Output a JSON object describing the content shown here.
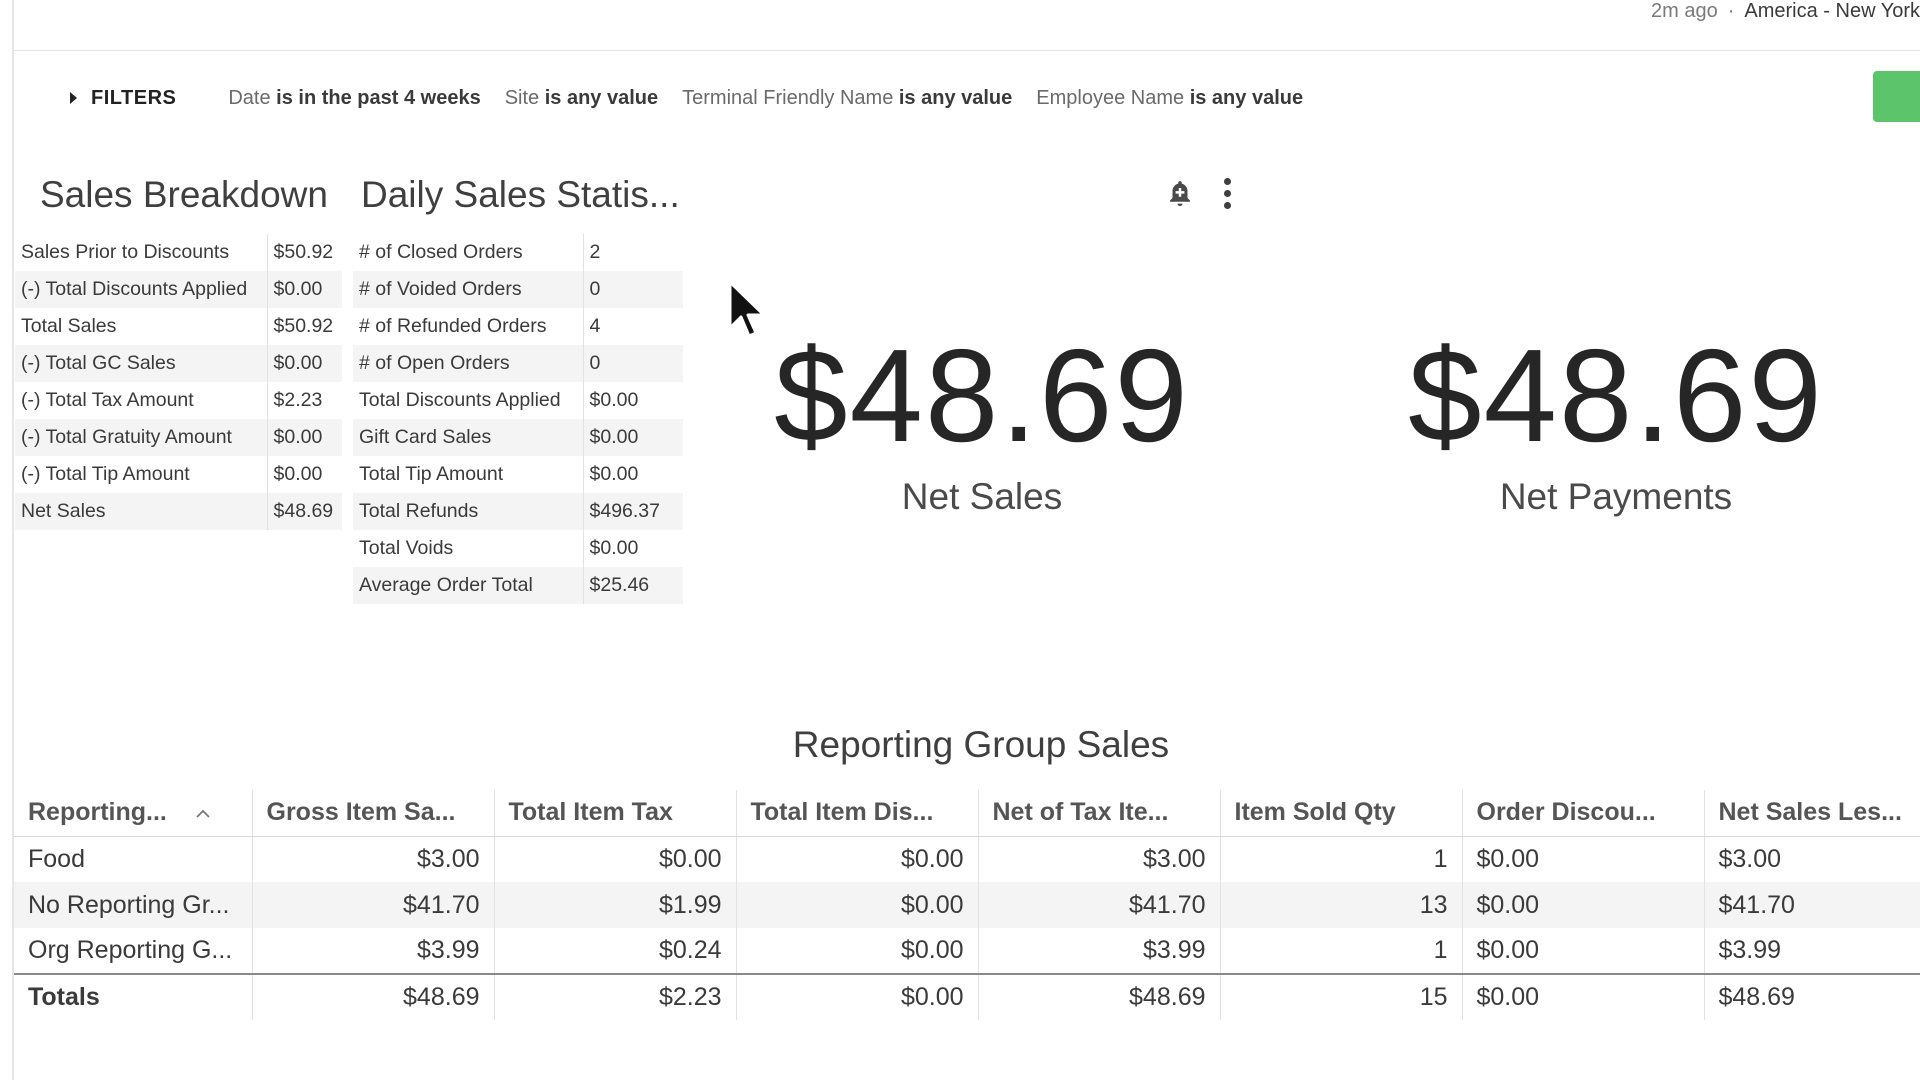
{
  "header": {
    "updated": "2m ago",
    "separator": "·",
    "timezone": "America - New York"
  },
  "filters": {
    "title": "FILTERS",
    "items": [
      {
        "field": "Date",
        "condition": "is in the past 4 weeks"
      },
      {
        "field": "Site",
        "condition": "is any value"
      },
      {
        "field": "Terminal Friendly Name",
        "condition": "is any value"
      },
      {
        "field": "Employee Name",
        "condition": "is any value"
      }
    ]
  },
  "sales_breakdown": {
    "title": "Sales Breakdown",
    "rows": [
      {
        "label": "Sales Prior to Discounts",
        "value": "$50.92"
      },
      {
        "label": "(-) Total Discounts Applied",
        "value": "$0.00"
      },
      {
        "label": "Total Sales",
        "value": "$50.92"
      },
      {
        "label": "(-) Total GC Sales",
        "value": "$0.00"
      },
      {
        "label": "(-) Total Tax Amount",
        "value": "$2.23"
      },
      {
        "label": "(-) Total Gratuity Amount",
        "value": "$0.00"
      },
      {
        "label": "(-) Total Tip Amount",
        "value": "$0.00"
      },
      {
        "label": "Net Sales",
        "value": "$48.69"
      }
    ]
  },
  "daily_sales": {
    "title": "Daily Sales Statis...",
    "rows": [
      {
        "label": "# of Closed Orders",
        "value": "2"
      },
      {
        "label": "# of Voided Orders",
        "value": "0"
      },
      {
        "label": "# of Refunded Orders",
        "value": "4"
      },
      {
        "label": "# of Open Orders",
        "value": "0"
      },
      {
        "label": "Total Discounts Applied",
        "value": "$0.00"
      },
      {
        "label": "Gift Card Sales",
        "value": "$0.00"
      },
      {
        "label": "Total Tip Amount",
        "value": "$0.00"
      },
      {
        "label": "Total Refunds",
        "value": "$496.37"
      },
      {
        "label": "Total Voids",
        "value": "$0.00"
      },
      {
        "label": "Average Order Total",
        "value": "$25.46"
      }
    ]
  },
  "kpis": {
    "net_sales": {
      "value": "$48.69",
      "label": "Net Sales"
    },
    "net_payments": {
      "value": "$48.69",
      "label": "Net Payments"
    }
  },
  "icons": {
    "alert": "bell-plus-icon",
    "menu": "vertical-dots-icon",
    "sort": "chevron-up-icon"
  },
  "reporting_group": {
    "title": "Reporting Group Sales",
    "columns": [
      "Reporting...",
      "Gross Item Sa...",
      "Total Item Tax",
      "Total Item Dis...",
      "Net of Tax Ite...",
      "Item Sold Qty",
      "Order Discou...",
      "Net Sales Les..."
    ],
    "rows": [
      [
        "Food",
        "$3.00",
        "$0.00",
        "$0.00",
        "$3.00",
        "1",
        "$0.00",
        "$3.00"
      ],
      [
        "No Reporting Gr...",
        "$41.70",
        "$1.99",
        "$0.00",
        "$41.70",
        "13",
        "$0.00",
        "$41.70"
      ],
      [
        "Org Reporting G...",
        "$3.99",
        "$0.24",
        "$0.00",
        "$3.99",
        "1",
        "$0.00",
        "$3.99"
      ]
    ],
    "totals": [
      "Totals",
      "$48.69",
      "$2.23",
      "$0.00",
      "$48.69",
      "15",
      "$0.00",
      "$48.69"
    ]
  },
  "colors": {
    "accent_green": "#5cc46b",
    "text": "#3a3a3a",
    "stripe": "#f4f4f4"
  }
}
